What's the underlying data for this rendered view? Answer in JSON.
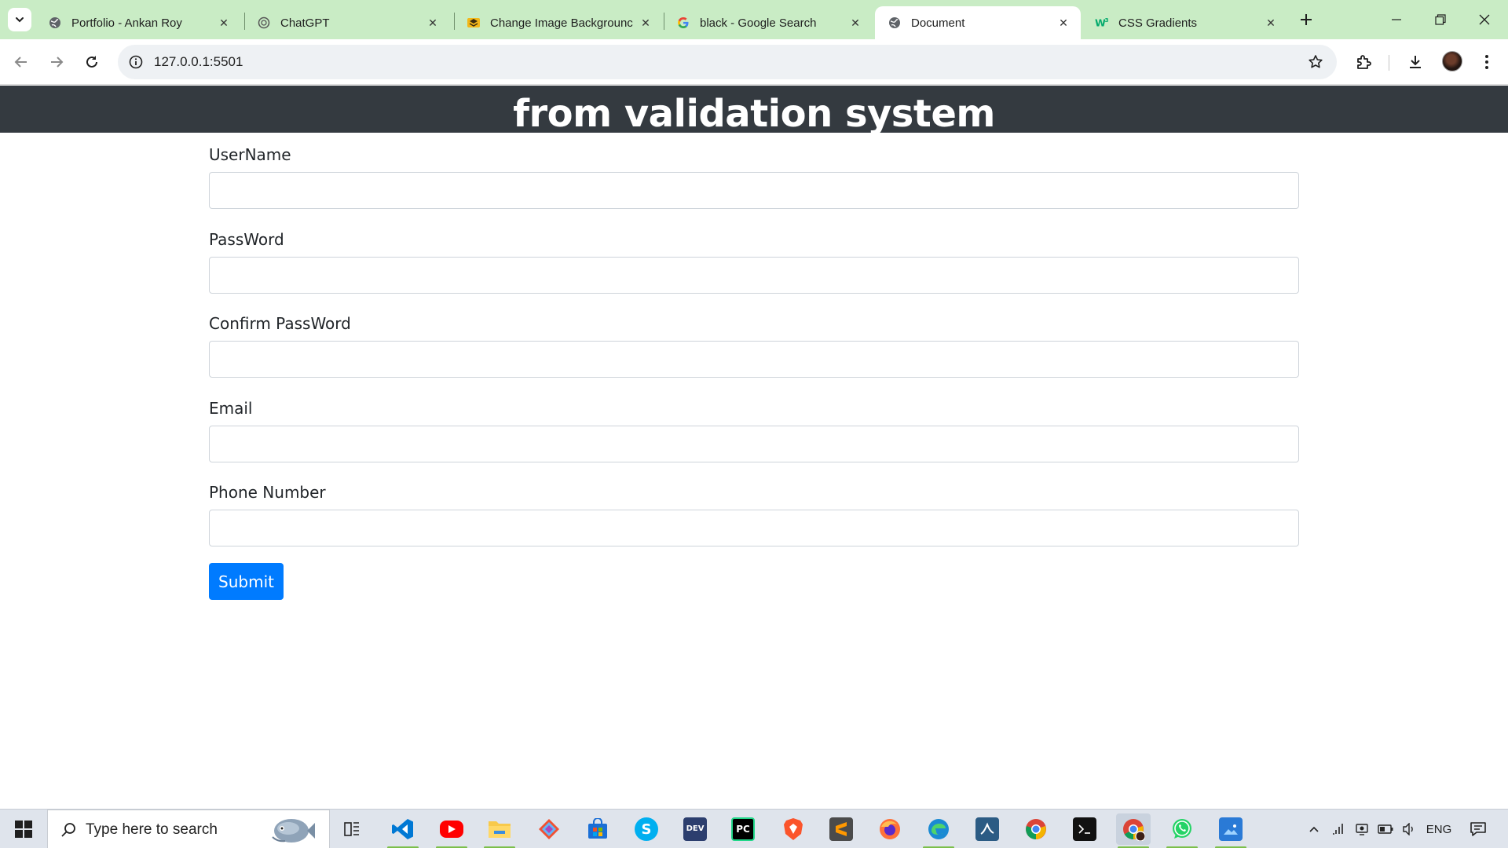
{
  "browser": {
    "tabs": [
      {
        "title": "Portfolio - Ankan Roy",
        "favicon": "globe-icon"
      },
      {
        "title": "ChatGPT",
        "favicon": "openai-icon"
      },
      {
        "title": "Change Image Backgrounc",
        "favicon": "remove-bg-icon"
      },
      {
        "title": "black - Google Search",
        "favicon": "google-icon"
      },
      {
        "title": "Document",
        "favicon": "globe-icon",
        "active": true
      },
      {
        "title": "CSS Gradients",
        "favicon": "w3-icon"
      }
    ],
    "url": "127.0.0.1:5501",
    "theme_color": "#c9ecc5"
  },
  "page": {
    "title": "from validation system",
    "header_color": "#343a40",
    "fields": [
      {
        "label": "UserName",
        "value": ""
      },
      {
        "label": "PassWord",
        "value": ""
      },
      {
        "label": "Confirm PassWord",
        "value": ""
      },
      {
        "label": "Email",
        "value": ""
      },
      {
        "label": "Phone Number",
        "value": ""
      }
    ],
    "submit_label": "Submit",
    "submit_color": "#007bff"
  },
  "taskbar": {
    "search_placeholder": "Type here to search",
    "apps": [
      "task-view",
      "vscode",
      "youtube",
      "file-explorer",
      "git",
      "microsoft-store",
      "skype",
      "dev-cpp",
      "pycharm",
      "brave",
      "sublime-text",
      "firefox",
      "edge",
      "mysql-workbench",
      "chrome",
      "terminal",
      "chrome-profile",
      "whatsapp",
      "photos"
    ],
    "language": "ENG"
  }
}
